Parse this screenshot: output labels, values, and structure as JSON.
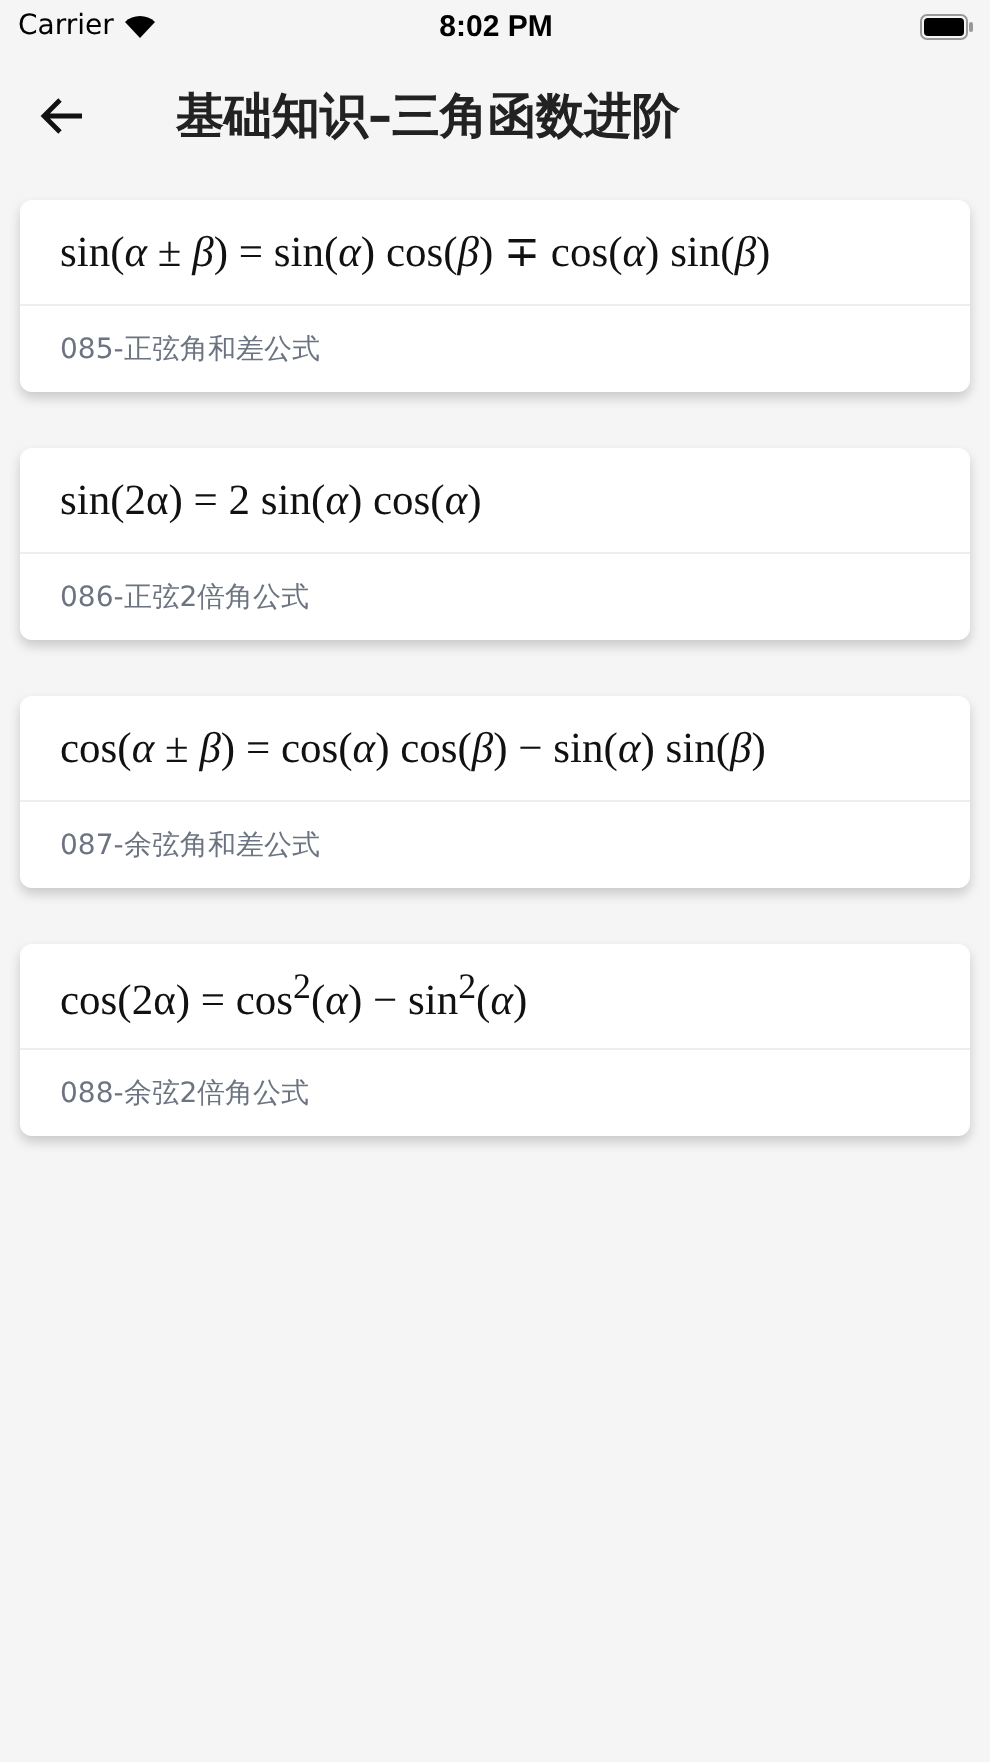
{
  "status_bar": {
    "carrier": "Carrier",
    "time": "8:02 PM"
  },
  "header": {
    "title": "基础知识–三角函数进阶"
  },
  "cards": [
    {
      "formula": "sin(*α* ± *β*) = sin(*α*) cos(*β*) ∓ cos(*α*) sin(*β*)",
      "label": "085-正弦角和差公式"
    },
    {
      "formula": "sin(2α) = 2 sin(*α*) cos(*α*)",
      "label": "086-正弦2倍角公式"
    },
    {
      "formula": "cos(*α* ± *β*) = cos(*α*) cos(*β*) − sin(*α*) sin(*β*)",
      "label": "087-余弦角和差公式"
    },
    {
      "formula": "cos(2α) = cos$^{2}$(*α*) − sin$^{2}$(*α*)",
      "label": "088-余弦2倍角公式"
    }
  ]
}
